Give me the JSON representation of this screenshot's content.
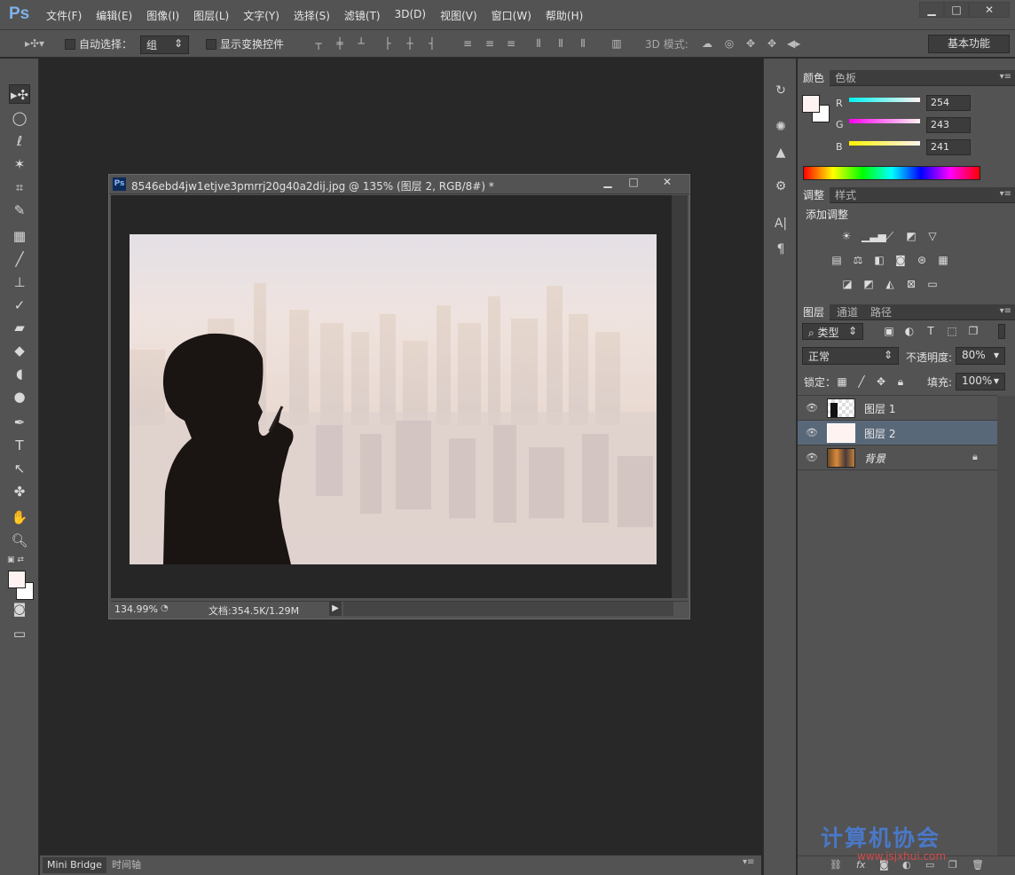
{
  "app": {
    "logo": "Ps"
  },
  "menu": [
    "文件(F)",
    "编辑(E)",
    "图像(I)",
    "图层(L)",
    "文字(Y)",
    "选择(S)",
    "滤镜(T)",
    "3D(D)",
    "视图(V)",
    "窗口(W)",
    "帮助(H)"
  ],
  "window_buttons": [
    "minimize",
    "maximize",
    "close"
  ],
  "options": {
    "auto_select_label": "自动选择：",
    "auto_select_value": "组",
    "show_transform_label": "显示变换控件",
    "mode3d_label": "3D 模式:",
    "workspace": "基本功能"
  },
  "document": {
    "title": "8546ebd4jw1etjve3pmrrj20g40a2dij.jpg @ 135% (图层 2, RGB/8#) *",
    "zoom": "134.99%",
    "docinfo": "文档:354.5K/1.29M"
  },
  "bottom_tabs": [
    "Mini Bridge",
    "时间轴"
  ],
  "color_panel": {
    "tabs": [
      "颜色",
      "色板"
    ],
    "r_label": "R",
    "g_label": "G",
    "b_label": "B",
    "r": "254",
    "g": "243",
    "b": "241",
    "fg_color": "#fef3f1"
  },
  "adjust_panel": {
    "tabs": [
      "调整",
      "样式"
    ],
    "title": "添加调整"
  },
  "layers_panel": {
    "tabs": [
      "图层",
      "通道",
      "路径"
    ],
    "filter_label": "类型",
    "blend_mode": "正常",
    "opacity_label": "不透明度:",
    "opacity": "80%",
    "lock_label": "锁定：",
    "fill_label": "填充:",
    "fill": "100%",
    "layers": [
      {
        "name": "图层 1",
        "selected": false
      },
      {
        "name": "图层 2",
        "selected": true
      },
      {
        "name": "背景",
        "selected": false
      }
    ]
  },
  "watermark": {
    "text": "计算机协会",
    "url": "www.jsjxhui.com"
  }
}
